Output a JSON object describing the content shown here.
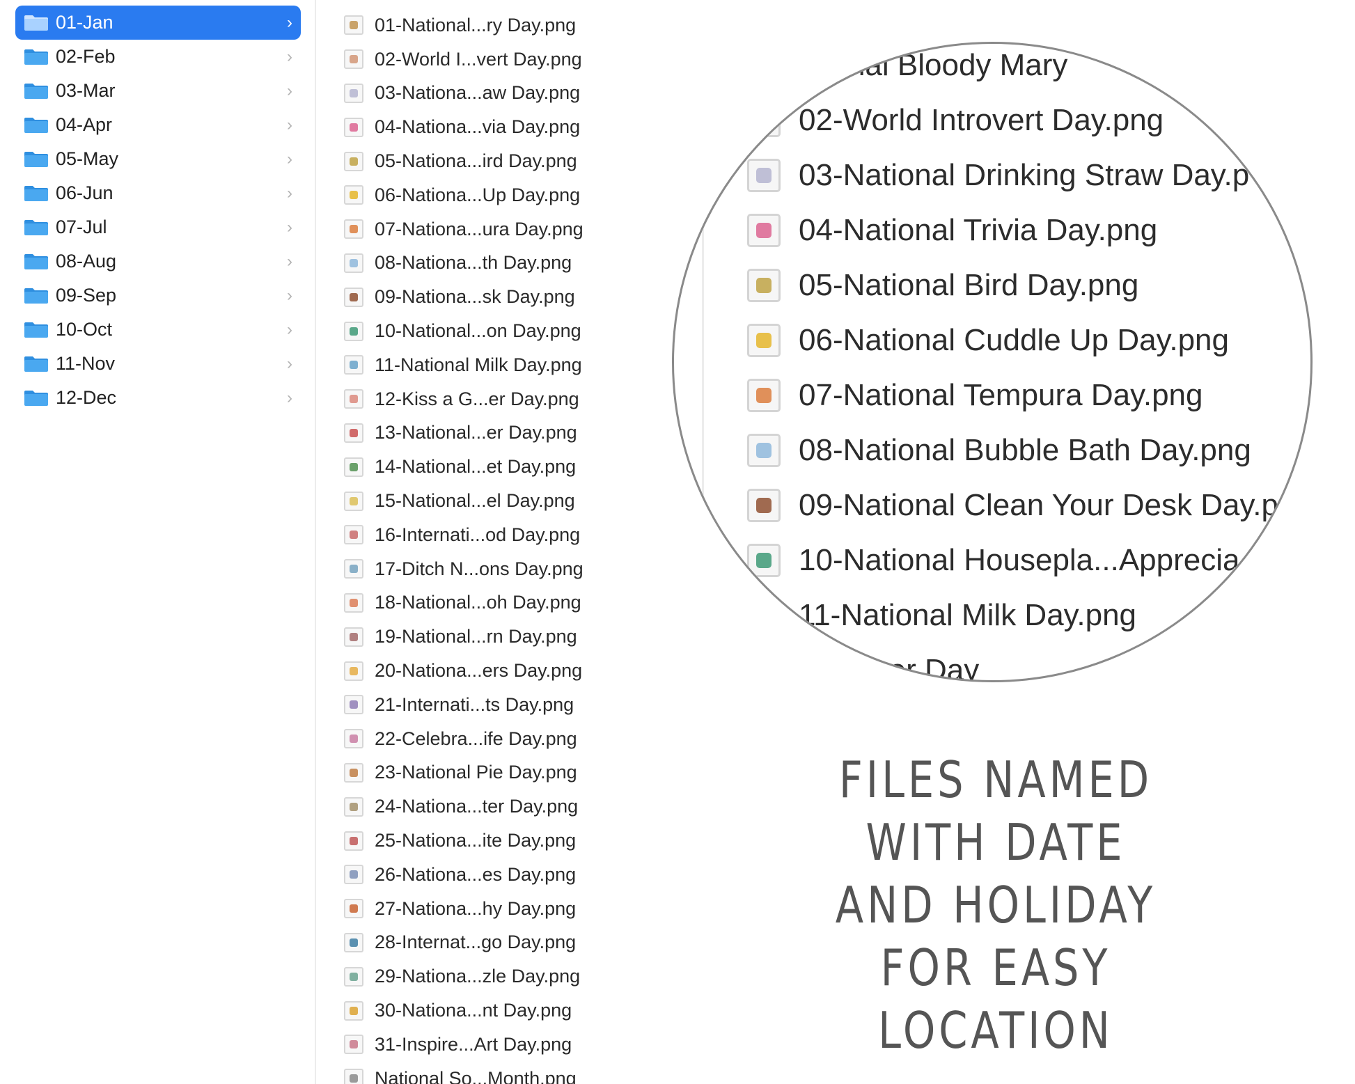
{
  "folders": [
    {
      "label": "01-Jan",
      "selected": true
    },
    {
      "label": "02-Feb"
    },
    {
      "label": "03-Mar"
    },
    {
      "label": "04-Apr"
    },
    {
      "label": "05-May"
    },
    {
      "label": "06-Jun"
    },
    {
      "label": "07-Jul"
    },
    {
      "label": "08-Aug"
    },
    {
      "label": "09-Sep"
    },
    {
      "label": "10-Oct"
    },
    {
      "label": "11-Nov"
    },
    {
      "label": "12-Dec"
    }
  ],
  "chevron": "›",
  "files": [
    {
      "name": "01-National...ry Day.png",
      "tint": "#c9a36a"
    },
    {
      "name": "02-World I...vert Day.png",
      "tint": "#d8a58a"
    },
    {
      "name": "03-Nationa...aw Day.png",
      "tint": "#bfbfd6"
    },
    {
      "name": "04-Nationa...via Day.png",
      "tint": "#e07aa0"
    },
    {
      "name": "05-Nationa...ird Day.png",
      "tint": "#c8b060"
    },
    {
      "name": "06-Nationa...Up Day.png",
      "tint": "#e8c04a"
    },
    {
      "name": "07-Nationa...ura Day.png",
      "tint": "#e0905a"
    },
    {
      "name": "08-Nationa...th Day.png",
      "tint": "#9fc2e0"
    },
    {
      "name": "09-Nationa...sk Day.png",
      "tint": "#a06a50"
    },
    {
      "name": "10-National...on Day.png",
      "tint": "#5aa88a"
    },
    {
      "name": "11-National Milk Day.png",
      "tint": "#7fb0d0"
    },
    {
      "name": "12-Kiss a G...er Day.png",
      "tint": "#e09a90"
    },
    {
      "name": "13-National...er Day.png",
      "tint": "#d06a6a"
    },
    {
      "name": "14-National...et Day.png",
      "tint": "#6aa06a"
    },
    {
      "name": "15-National...el Day.png",
      "tint": "#e0c870"
    },
    {
      "name": "16-Internati...od Day.png",
      "tint": "#d08080"
    },
    {
      "name": "17-Ditch N...ons Day.png",
      "tint": "#8ab0c8"
    },
    {
      "name": "18-National...oh Day.png",
      "tint": "#e09070"
    },
    {
      "name": "19-National...rn Day.png",
      "tint": "#b08080"
    },
    {
      "name": "20-Nationa...ers Day.png",
      "tint": "#e8b860"
    },
    {
      "name": "21-Internati...ts Day.png",
      "tint": "#a090c0"
    },
    {
      "name": "22-Celebra...ife Day.png",
      "tint": "#d090b0"
    },
    {
      "name": "23-National Pie Day.png",
      "tint": "#c89060"
    },
    {
      "name": "24-Nationa...ter Day.png",
      "tint": "#b0a080"
    },
    {
      "name": "25-Nationa...ite Day.png",
      "tint": "#c87070"
    },
    {
      "name": "26-Nationa...es Day.png",
      "tint": "#90a0c0"
    },
    {
      "name": "27-Nationa...hy Day.png",
      "tint": "#d07a50"
    },
    {
      "name": "28-Internat...go Day.png",
      "tint": "#5a90b0"
    },
    {
      "name": "29-Nationa...zle Day.png",
      "tint": "#80b0a0"
    },
    {
      "name": "30-Nationa...nt Day.png",
      "tint": "#e0b050"
    },
    {
      "name": "31-Inspire...Art Day.png",
      "tint": "#d08a9a"
    },
    {
      "name": "National So...Month.png",
      "tint": "#9a9a9a"
    }
  ],
  "magnified": [
    {
      "name": "ational Bloody Mary",
      "tint": "#c9a36a"
    },
    {
      "name": "02-World Introvert Day.png",
      "tint": "#d8a58a"
    },
    {
      "name": "03-National Drinking Straw Day.p",
      "tint": "#bfbfd6"
    },
    {
      "name": "04-National Trivia Day.png",
      "tint": "#e07aa0"
    },
    {
      "name": "05-National Bird Day.png",
      "tint": "#c8b060"
    },
    {
      "name": "06-National Cuddle Up Day.png",
      "tint": "#e8c04a"
    },
    {
      "name": "07-National Tempura Day.png",
      "tint": "#e0905a"
    },
    {
      "name": "08-National Bubble Bath Day.png",
      "tint": "#9fc2e0"
    },
    {
      "name": "09-National Clean Your Desk Day.p",
      "tint": "#a06a50"
    },
    {
      "name": "10-National Housepla...Apprecia",
      "tint": "#5aa88a"
    },
    {
      "name": "11-National Milk Day.png",
      "tint": "#7fb0d0"
    },
    {
      "name": "a Ginger Day",
      "tint": "#e09a90"
    }
  ],
  "caption": [
    "FILES NAMED",
    "WITH DATE",
    "AND HOLIDAY",
    "FOR EASY",
    "LOCATION"
  ],
  "colors": {
    "accent": "#2a7bf0",
    "folder": "#4aa8f0",
    "folder_tab": "#2f8fe0"
  }
}
